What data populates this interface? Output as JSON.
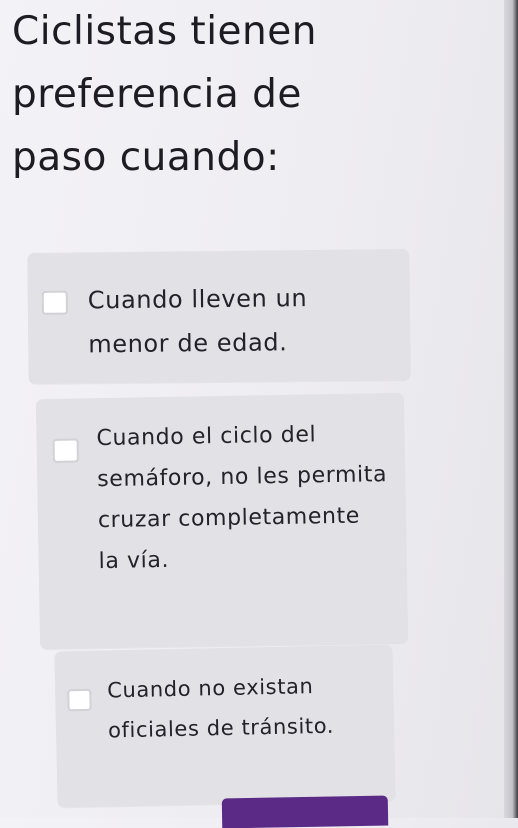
{
  "question": {
    "title": "Ciclistas tienen preferencia de paso cuando:"
  },
  "options": [
    {
      "label": "Cuando lleven un menor de edad.",
      "checked": false
    },
    {
      "label": "Cuando el ciclo del semáforo, no les permita cruzar completamente la vía.",
      "checked": false
    },
    {
      "label": "Cuando no existan oficiales de tránsito.",
      "checked": false
    }
  ],
  "colors": {
    "background": "#efeef2",
    "option_background": "#e2e1e6",
    "button": "#5a2a86"
  }
}
